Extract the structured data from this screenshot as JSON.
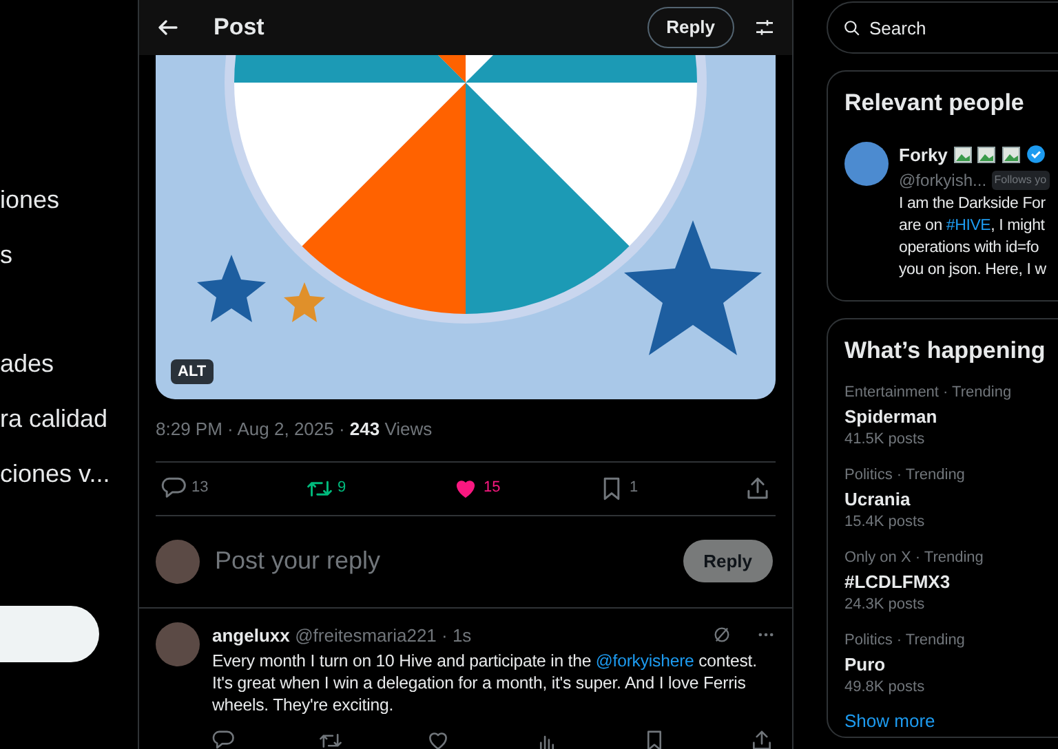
{
  "left_nav": {
    "items": [
      {
        "label": "iones"
      },
      {
        "label": "s"
      },
      {
        "label": "ades"
      },
      {
        "label": "ra calidad"
      },
      {
        "label": "ciones v..."
      }
    ]
  },
  "header": {
    "title": "Post",
    "reply_button": "Reply"
  },
  "media": {
    "alt_badge": "ALT"
  },
  "meta": {
    "time": "8:29 PM · Aug 2, 2025 · ",
    "views_count": "243",
    "views_label": "Views"
  },
  "actions": [
    {
      "kind": "reply",
      "count": "13",
      "active": false
    },
    {
      "kind": "repost",
      "count": "9",
      "active": true
    },
    {
      "kind": "like",
      "count": "15",
      "active": true
    },
    {
      "kind": "bookmark",
      "count": "1",
      "active": false
    },
    {
      "kind": "share"
    }
  ],
  "composer": {
    "placeholder": "Post your reply",
    "button": "Reply"
  },
  "reply": {
    "name": "angeluxx",
    "handle": "@freitesmaria221",
    "time": "· 1s",
    "text_before": "Every month I turn on 10 Hive and participate in the ",
    "mention": "@forkyishere",
    "text_after": "  contest. It's great when I win a delegation for a month, it's super.  And I love Ferris wheels. They're exciting.",
    "actions": [
      {
        "kind": "reply"
      },
      {
        "kind": "repost"
      },
      {
        "kind": "like"
      },
      {
        "kind": "views"
      },
      {
        "kind": "bookmark"
      },
      {
        "kind": "share"
      }
    ]
  },
  "search": {
    "placeholder": "Search"
  },
  "relevant_people": {
    "title": "Relevant people",
    "person": {
      "name": "Forky",
      "badges": [
        {
          "kind": "broken-image"
        },
        {
          "kind": "broken-image"
        },
        {
          "kind": "broken-image"
        },
        {
          "kind": "verified"
        }
      ],
      "handle": "@forkyish...",
      "follows_badge": "Follows yo",
      "bio_lines": [
        [
          {
            "text": "I am the Darkside For"
          }
        ],
        [
          {
            "text": "are on "
          },
          {
            "text": "#HIVE",
            "kind": "hashtag"
          },
          {
            "text": ", I might"
          }
        ],
        [
          {
            "text": "operations with id=fo"
          }
        ],
        [
          {
            "text": "you on json. Here, I w"
          }
        ]
      ]
    }
  },
  "trends": {
    "title": "What’s happening",
    "items": [
      {
        "context": "Entertainment · Trending",
        "name": "Spiderman",
        "posts": "41.5K posts"
      },
      {
        "context": "Politics · Trending",
        "name": "Ucrania",
        "posts": "15.4K posts"
      },
      {
        "context": "Only on X · Trending",
        "name": "#LCDLFMX3",
        "posts": "24.3K posts"
      },
      {
        "context": "Politics · Trending",
        "name": "Puro",
        "posts": "49.8K posts"
      }
    ],
    "show_more": "Show more"
  }
}
